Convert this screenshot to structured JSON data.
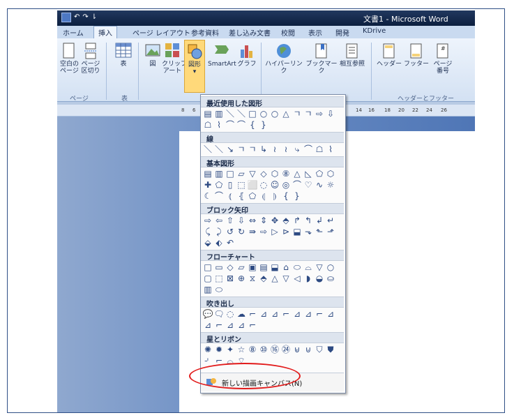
{
  "window": {
    "title": "文書1 - Microsoft Word"
  },
  "quick_access": {
    "undo": "↶",
    "redo": "↷",
    "sep": "⇂"
  },
  "tabs": [
    "ホーム",
    "挿入",
    "ページ レイアウト",
    "参考資料",
    "差し込み文書",
    "校閲",
    "表示",
    "開発",
    "KDrive"
  ],
  "active_tab": "挿入",
  "ribbon": {
    "page_group": {
      "label": "ページ",
      "cover": "空白の\nページ",
      "break": "ページ\n区切り"
    },
    "table_group": {
      "label": "表",
      "table": "表"
    },
    "illust_group": {
      "picture": "図",
      "clipart": "クリップ\nアート",
      "shapes": "図形",
      "smartart": "SmartArt",
      "chart": "グラフ"
    },
    "links_group": {
      "hyperlink": "ハイパーリンク",
      "bookmark": "ブックマーク",
      "crossref": "相互参照"
    },
    "hf_group": {
      "label": "ヘッダーとフッター",
      "header": "ヘッダー",
      "footer": "フッター",
      "pageno": "ページ\n番号"
    }
  },
  "ruler": {
    "numbers": [
      "8",
      "6",
      "14",
      "16",
      "18",
      "20",
      "22",
      "24",
      "26"
    ]
  },
  "shapes_menu": {
    "sections": [
      {
        "title": "最近使用した図形",
        "glyphs": [
          "▤",
          "▥",
          "＼",
          "＼",
          "□",
          "○",
          "○",
          "△",
          "ㄱ",
          "ㄱ",
          "⇨",
          "⇩",
          "☖",
          "⌇",
          "⌒",
          "⌒",
          "{",
          "}"
        ]
      },
      {
        "title": "線",
        "glyphs": [
          "＼",
          "＼",
          "↘",
          "ㄱ",
          "ㄱ",
          "↳",
          "≀",
          "≀",
          "⤷",
          "⌒",
          "☖",
          "⌇"
        ]
      },
      {
        "title": "基本図形",
        "glyphs": [
          "▤",
          "▥",
          "□",
          "▱",
          "▽",
          "◇",
          "⬡",
          "⑧",
          "△",
          "◺",
          "⬠",
          "⬡",
          "✚",
          "⬠",
          "▯",
          "⬚",
          "⬜",
          "◌",
          "☺",
          "◎",
          "⌒",
          "♡",
          "∿",
          "☼",
          "☾",
          "⌒",
          "⦅",
          "⦃",
          "⬠",
          "⦇",
          "⦈",
          "{",
          "}"
        ]
      },
      {
        "title": "ブロック矢印",
        "glyphs": [
          "⇨",
          "⇦",
          "⇧",
          "⇩",
          "⇔",
          "⇕",
          "✥",
          "⬘",
          "↱",
          "↰",
          "↲",
          "↵",
          "⤹",
          "⤸",
          "↺",
          "↻",
          "⇛",
          "⇨",
          "▷",
          "⊳",
          "⬓",
          "⬎",
          "⬑",
          "⬏",
          "⬙",
          "⬖",
          "↶"
        ]
      },
      {
        "title": "フローチャート",
        "glyphs": [
          "□",
          "▭",
          "◇",
          "▱",
          "▣",
          "▤",
          "⬓",
          "⌂",
          "⬭",
          "⌓",
          "▽",
          "○",
          "▢",
          "⬚",
          "⊠",
          "⊕",
          "⧖",
          "⬘",
          "△",
          "▽",
          "◁",
          "◗",
          "◒",
          "⛀",
          "▥",
          "⬭"
        ]
      },
      {
        "title": "吹き出し",
        "glyphs": [
          "💬",
          "🗨",
          "◌",
          "☁",
          "⌐",
          "⊿",
          "⊿",
          "⌐",
          "⊿",
          "⊿",
          "⌐",
          "⊿",
          "⊿",
          "⌐",
          "⊿",
          "⊿",
          "⌐"
        ]
      },
      {
        "title": "星とリボン",
        "glyphs": [
          "✺",
          "✹",
          "✦",
          "☆",
          "⑧",
          "⑩",
          "⑯",
          "㉔",
          "⊌",
          "⊍",
          "⛉",
          "⛊",
          "⌏",
          "⌐",
          "⌓",
          "⌔"
        ]
      }
    ],
    "canvas_label": "新しい描画キャンバス(N)"
  },
  "colors": {
    "annotation": "#e21b1b",
    "ribbon_text": "#1d2f52"
  }
}
